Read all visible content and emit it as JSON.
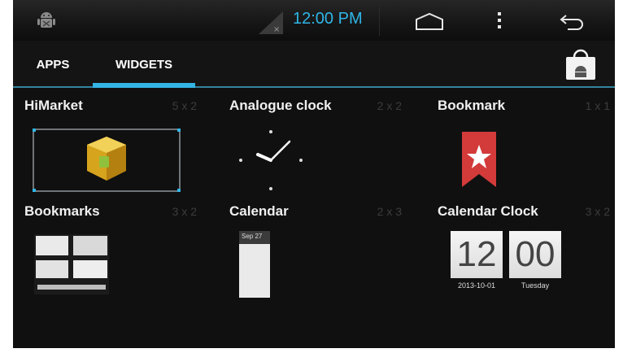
{
  "status_bar": {
    "time": "12:00 PM"
  },
  "tabs": [
    {
      "label": "APPS"
    },
    {
      "label": "WIDGETS"
    }
  ],
  "widgets": [
    {
      "name": "HiMarket",
      "size": "5 x 2"
    },
    {
      "name": "Analogue clock",
      "size": "2 x 2"
    },
    {
      "name": "Bookmark",
      "size": "1 x 1"
    },
    {
      "name": "Bookmarks",
      "size": "3 x 2"
    },
    {
      "name": "Calendar",
      "size": "2 x 3"
    },
    {
      "name": "Calendar Clock",
      "size": "3 x 2"
    }
  ],
  "calendar_preview": {
    "date": "Sep 27"
  },
  "calendar_clock_preview": {
    "hours": "12",
    "minutes": "00",
    "date": "2013-10-01",
    "weekday": "Tuesday"
  },
  "icons": [
    "android-debug-icon",
    "signal-icon",
    "home-icon",
    "overflow-menu-icon",
    "back-icon",
    "play-store-icon"
  ],
  "colors": {
    "accent": "#33b5e5",
    "background": "#101010",
    "clock": "#2fb6e8"
  }
}
